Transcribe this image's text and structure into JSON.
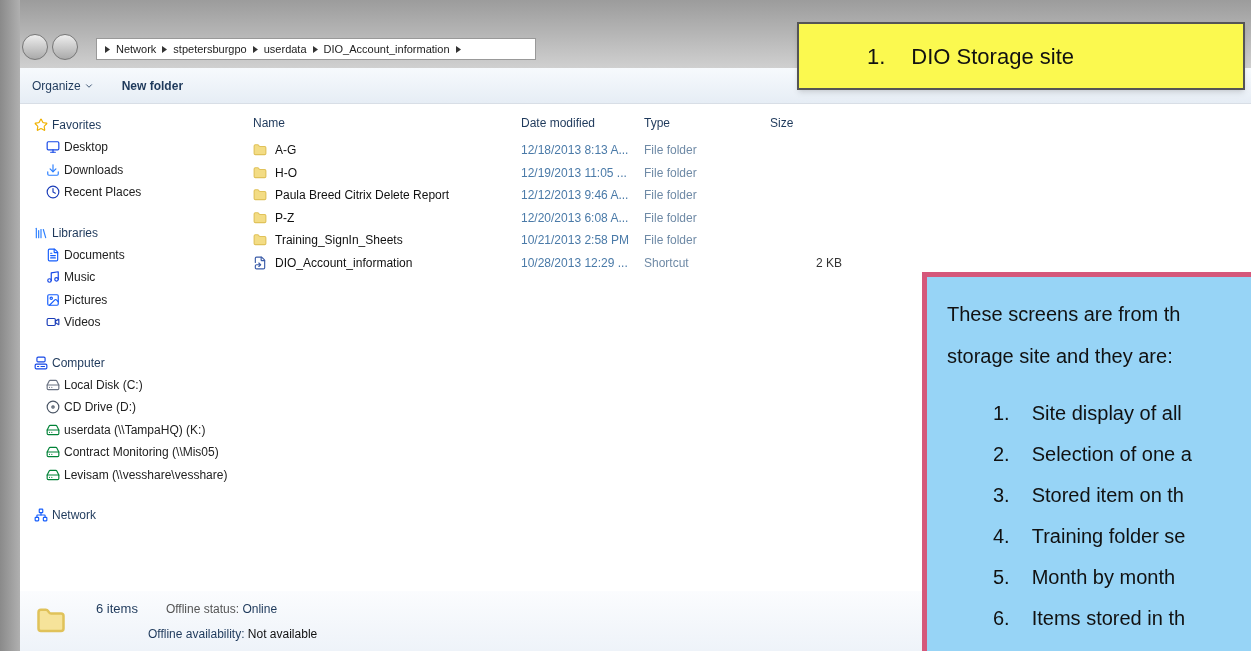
{
  "address": {
    "segments": [
      "Network",
      "stpetersburgpo",
      "userdata",
      "DIO_Account_information"
    ]
  },
  "toolbar": [
    {
      "label": "Organize",
      "kind": "menu"
    },
    {
      "label": "New folder",
      "kind": "button"
    }
  ],
  "nav": [
    {
      "label": "Favorites",
      "children": [
        {
          "label": "Desktop"
        },
        {
          "label": "Downloads"
        },
        {
          "label": "Recent Places"
        }
      ]
    },
    {
      "label": "Libraries",
      "children": [
        {
          "label": "Documents"
        },
        {
          "label": "Music"
        },
        {
          "label": "Pictures"
        },
        {
          "label": "Videos"
        }
      ]
    },
    {
      "label": "Computer",
      "children": [
        {
          "label": "Local Disk (C:)"
        },
        {
          "label": "CD Drive (D:)"
        },
        {
          "label": "userdata (\\\\TampaHQ) (K:)"
        },
        {
          "label": "Contract Monitoring (\\\\Mis05)"
        },
        {
          "label": "Levisam (\\\\vesshare\\vesshare)"
        }
      ]
    },
    {
      "label": "Network"
    }
  ],
  "table": {
    "columns": [
      "Name",
      "Date modified",
      "Type",
      "Size"
    ],
    "rows": [
      {
        "kind": "folder",
        "name": "A-G",
        "date": "12/18/2013 8:13 A...",
        "type": "File folder"
      },
      {
        "kind": "folder",
        "name": "H-O",
        "date": "12/19/2013 11:05 ...",
        "type": "File folder"
      },
      {
        "kind": "folder",
        "name": "Paula Breed Citrix Delete Report",
        "date": "12/12/2013 9:46 A...",
        "type": "File folder"
      },
      {
        "kind": "folder",
        "name": "P-Z",
        "date": "12/20/2013 6:08 A...",
        "type": "File folder"
      },
      {
        "kind": "folder",
        "name": "Training_SignIn_Sheets",
        "date": "10/21/2013 2:58 PM",
        "type": "File folder"
      },
      {
        "kind": "shortcut",
        "name": "DIO_Account_information",
        "date": "10/28/2013 12:29 ...",
        "type": "Shortcut",
        "size": "2 KB"
      }
    ]
  },
  "status": {
    "count": "6 items",
    "offline_status_label": "Offline status:",
    "offline_status": "Online",
    "availability_label": "Offline availability:",
    "availability": "Not available"
  },
  "callouts": [
    {
      "kind": "title",
      "number": "1.",
      "text": "DIO Storage site"
    },
    {
      "kind": "list",
      "intro": "These screens are from th\nstorage site and they are:",
      "items": [
        {
          "number": "1.",
          "text": "Site display of all"
        },
        {
          "number": "2.",
          "text": "Selection of one a"
        },
        {
          "number": "3.",
          "text": "Stored item on th"
        },
        {
          "number": "4.",
          "text": "Training folder se"
        },
        {
          "number": "5.",
          "text": "Month by month"
        },
        {
          "number": "6.",
          "text": "Items stored in th"
        }
      ]
    }
  ]
}
